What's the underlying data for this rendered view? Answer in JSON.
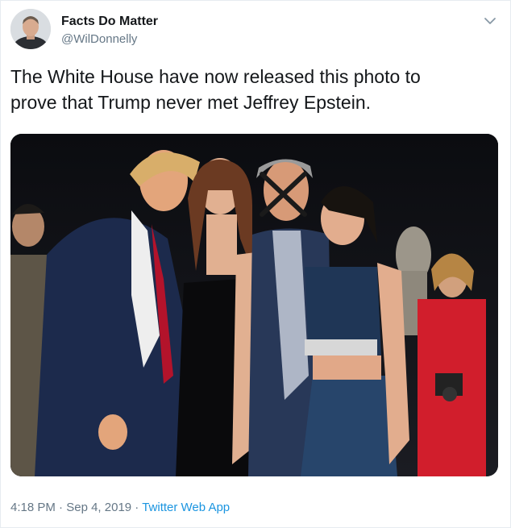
{
  "author": {
    "name": "Facts Do Matter",
    "handle": "@WilDonnelly",
    "avatar_icon": "profile-photo"
  },
  "tweet": {
    "text_line1": "The White House have now released this photo to",
    "text_line2": "prove that Trump never met Jeffrey Epstein.",
    "time": "4:18 PM",
    "sep1": " · ",
    "date": "Sep 4, 2019",
    "sep2": " · ",
    "source": "Twitter Web App"
  },
  "menu_icon": "chevron-down-icon",
  "colors": {
    "link": "#1b95e0",
    "secondary_text": "#657786",
    "border": "#e6ecf0"
  }
}
